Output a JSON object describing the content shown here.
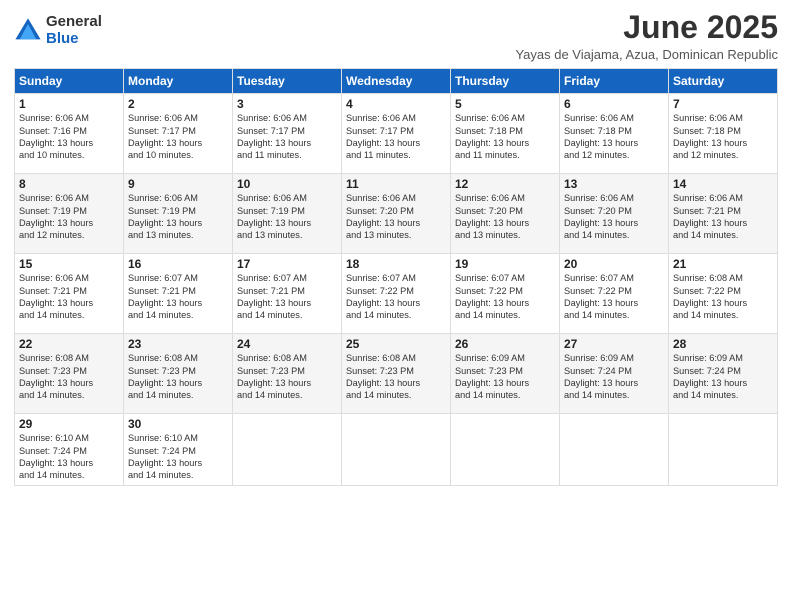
{
  "logo": {
    "general": "General",
    "blue": "Blue"
  },
  "title": "June 2025",
  "location": "Yayas de Viajama, Azua, Dominican Republic",
  "headers": [
    "Sunday",
    "Monday",
    "Tuesday",
    "Wednesday",
    "Thursday",
    "Friday",
    "Saturday"
  ],
  "weeks": [
    [
      {
        "day": "1",
        "info": "Sunrise: 6:06 AM\nSunset: 7:16 PM\nDaylight: 13 hours\nand 10 minutes."
      },
      {
        "day": "2",
        "info": "Sunrise: 6:06 AM\nSunset: 7:17 PM\nDaylight: 13 hours\nand 10 minutes."
      },
      {
        "day": "3",
        "info": "Sunrise: 6:06 AM\nSunset: 7:17 PM\nDaylight: 13 hours\nand 11 minutes."
      },
      {
        "day": "4",
        "info": "Sunrise: 6:06 AM\nSunset: 7:17 PM\nDaylight: 13 hours\nand 11 minutes."
      },
      {
        "day": "5",
        "info": "Sunrise: 6:06 AM\nSunset: 7:18 PM\nDaylight: 13 hours\nand 11 minutes."
      },
      {
        "day": "6",
        "info": "Sunrise: 6:06 AM\nSunset: 7:18 PM\nDaylight: 13 hours\nand 12 minutes."
      },
      {
        "day": "7",
        "info": "Sunrise: 6:06 AM\nSunset: 7:18 PM\nDaylight: 13 hours\nand 12 minutes."
      }
    ],
    [
      {
        "day": "8",
        "info": "Sunrise: 6:06 AM\nSunset: 7:19 PM\nDaylight: 13 hours\nand 12 minutes."
      },
      {
        "day": "9",
        "info": "Sunrise: 6:06 AM\nSunset: 7:19 PM\nDaylight: 13 hours\nand 13 minutes."
      },
      {
        "day": "10",
        "info": "Sunrise: 6:06 AM\nSunset: 7:19 PM\nDaylight: 13 hours\nand 13 minutes."
      },
      {
        "day": "11",
        "info": "Sunrise: 6:06 AM\nSunset: 7:20 PM\nDaylight: 13 hours\nand 13 minutes."
      },
      {
        "day": "12",
        "info": "Sunrise: 6:06 AM\nSunset: 7:20 PM\nDaylight: 13 hours\nand 13 minutes."
      },
      {
        "day": "13",
        "info": "Sunrise: 6:06 AM\nSunset: 7:20 PM\nDaylight: 13 hours\nand 14 minutes."
      },
      {
        "day": "14",
        "info": "Sunrise: 6:06 AM\nSunset: 7:21 PM\nDaylight: 13 hours\nand 14 minutes."
      }
    ],
    [
      {
        "day": "15",
        "info": "Sunrise: 6:06 AM\nSunset: 7:21 PM\nDaylight: 13 hours\nand 14 minutes."
      },
      {
        "day": "16",
        "info": "Sunrise: 6:07 AM\nSunset: 7:21 PM\nDaylight: 13 hours\nand 14 minutes."
      },
      {
        "day": "17",
        "info": "Sunrise: 6:07 AM\nSunset: 7:21 PM\nDaylight: 13 hours\nand 14 minutes."
      },
      {
        "day": "18",
        "info": "Sunrise: 6:07 AM\nSunset: 7:22 PM\nDaylight: 13 hours\nand 14 minutes."
      },
      {
        "day": "19",
        "info": "Sunrise: 6:07 AM\nSunset: 7:22 PM\nDaylight: 13 hours\nand 14 minutes."
      },
      {
        "day": "20",
        "info": "Sunrise: 6:07 AM\nSunset: 7:22 PM\nDaylight: 13 hours\nand 14 minutes."
      },
      {
        "day": "21",
        "info": "Sunrise: 6:08 AM\nSunset: 7:22 PM\nDaylight: 13 hours\nand 14 minutes."
      }
    ],
    [
      {
        "day": "22",
        "info": "Sunrise: 6:08 AM\nSunset: 7:23 PM\nDaylight: 13 hours\nand 14 minutes."
      },
      {
        "day": "23",
        "info": "Sunrise: 6:08 AM\nSunset: 7:23 PM\nDaylight: 13 hours\nand 14 minutes."
      },
      {
        "day": "24",
        "info": "Sunrise: 6:08 AM\nSunset: 7:23 PM\nDaylight: 13 hours\nand 14 minutes."
      },
      {
        "day": "25",
        "info": "Sunrise: 6:08 AM\nSunset: 7:23 PM\nDaylight: 13 hours\nand 14 minutes."
      },
      {
        "day": "26",
        "info": "Sunrise: 6:09 AM\nSunset: 7:23 PM\nDaylight: 13 hours\nand 14 minutes."
      },
      {
        "day": "27",
        "info": "Sunrise: 6:09 AM\nSunset: 7:24 PM\nDaylight: 13 hours\nand 14 minutes."
      },
      {
        "day": "28",
        "info": "Sunrise: 6:09 AM\nSunset: 7:24 PM\nDaylight: 13 hours\nand 14 minutes."
      }
    ],
    [
      {
        "day": "29",
        "info": "Sunrise: 6:10 AM\nSunset: 7:24 PM\nDaylight: 13 hours\nand 14 minutes."
      },
      {
        "day": "30",
        "info": "Sunrise: 6:10 AM\nSunset: 7:24 PM\nDaylight: 13 hours\nand 14 minutes."
      },
      {
        "day": "",
        "info": ""
      },
      {
        "day": "",
        "info": ""
      },
      {
        "day": "",
        "info": ""
      },
      {
        "day": "",
        "info": ""
      },
      {
        "day": "",
        "info": ""
      }
    ]
  ]
}
